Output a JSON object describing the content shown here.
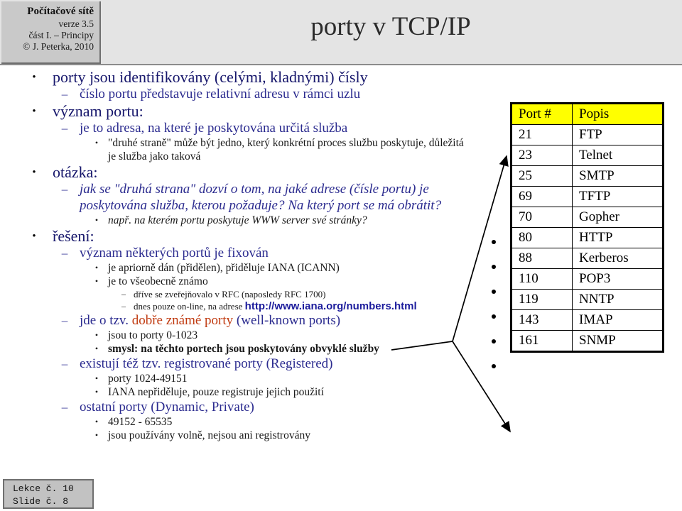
{
  "header": {
    "brand_title": "Počítačové sítě",
    "brand_version": "verze 3.5",
    "brand_part": "část I.  –  Principy",
    "brand_copyright": "© J. Peterka, 2010",
    "slide_title": "porty v TCP/IP"
  },
  "footer": {
    "lecture": "Lekce č. 10",
    "slide": "Slide č. 8"
  },
  "colors": {
    "bullet_blue": "#16166b",
    "sub_blue": "#2b2b8f",
    "accent_red": "#c03a10",
    "url_blue": "#1c1c9c",
    "table_header_bg": "#ffff00",
    "header_band_bg": "#e4e4e4",
    "brand_box_bg": "#c9c9c9"
  },
  "bullets": {
    "b1": "porty jsou identifikovány (celými, kladnými) čísly",
    "b2": "číslo portu představuje relativní adresu v rámci uzlu",
    "b3": "význam portu:",
    "b4": "je to adresa, na které je poskytována určitá služba",
    "b5a": "\"druhé straně\" může být jedno, který konkrétní proces službu poskytuje, důležitá",
    "b5b": "je služba jako taková",
    "b6": "otázka:",
    "b7a": "jak se \"druhá strana\" dozví o tom, na jaké adrese (čísle portu) je",
    "b7b": "poskytována služba, kterou požaduje? Na který port se má obrátit?",
    "b8": "např. na kterém portu poskytuje WWW server své stránky?",
    "b9": "řešení:",
    "b10": "význam některých portů je fixován",
    "b11": "je apriorně dán (přidělen), přiděluje IANA (ICANN)",
    "b12": "je to všeobecně známo",
    "b13": "dříve se zveřejňovalo v RFC (naposledy RFC 1700)",
    "b14_pre": "dnes pouze on-line, na adrese ",
    "b14_url": "http://www.iana.org/numbers.html",
    "b15_pre": "jde o tzv. ",
    "b15_red": "dobře známé porty",
    "b15_post": " (well-known ports)",
    "b16": "jsou to porty 0-1023",
    "b17": "smysl: na těchto portech jsou poskytovány obvyklé služby",
    "b18": "existují též tzv. registrované porty (Registered)",
    "b19": "porty 1024-49151",
    "b20": "IANA nepřiděluje, pouze registruje jejich použití",
    "b21": "ostatní porty (Dynamic, Private)",
    "b22": "49152 - 65535",
    "b23": "jsou používány volně, nejsou ani registrovány"
  },
  "markers": {
    "dot": "•",
    "dash": "–"
  },
  "port_table": {
    "headers": [
      "Port #",
      "Popis"
    ],
    "rows": [
      {
        "port": "21",
        "desc": "FTP"
      },
      {
        "port": "23",
        "desc": "Telnet"
      },
      {
        "port": "25",
        "desc": "SMTP"
      },
      {
        "port": "69",
        "desc": "TFTP"
      },
      {
        "port": "70",
        "desc": "Gopher"
      },
      {
        "port": "80",
        "desc": "HTTP"
      },
      {
        "port": "88",
        "desc": "Kerberos"
      },
      {
        "port": "110",
        "desc": "POP3"
      },
      {
        "port": "119",
        "desc": "NNTP"
      },
      {
        "port": "143",
        "desc": "IMAP"
      },
      {
        "port": "161",
        "desc": "SNMP"
      }
    ]
  }
}
